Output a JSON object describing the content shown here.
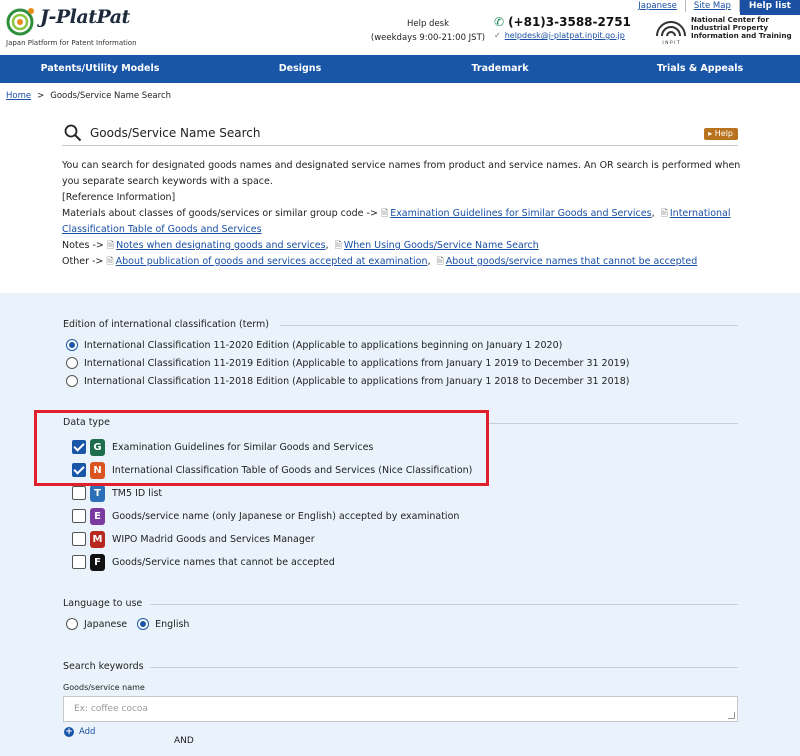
{
  "header": {
    "logo_text": "J-PlatPat",
    "logo_sub": "Japan Platform for Patent Information",
    "helpdesk_label": "Help desk",
    "helpdesk_hours": "(weekdays 9:00-21:00 JST)",
    "phone": "(+81)3-3588-2751",
    "email": "helpdesk@j-platpat.inpit.go.jp",
    "inpit_lines": [
      "National Center for",
      "Industrial Property",
      "Information and Training"
    ],
    "inpit_mark_text": "I N P I T",
    "top_links": {
      "japanese": "Japanese",
      "site_map": "Site Map",
      "help_list": "Help list"
    }
  },
  "nav": [
    "Patents/Utility Models",
    "Designs",
    "Trademark",
    "Trials & Appeals"
  ],
  "breadcrumb": {
    "home": "Home",
    "sep": ">",
    "current": "Goods/Service Name Search"
  },
  "page": {
    "title": "Goods/Service Name Search",
    "help_label": "Help",
    "intro": "You can search for designated goods names and designated service names from product and service names. An OR search is performed when you separate search keywords with a space.",
    "ref_info": "[Reference Information]",
    "materials_prefix": "Materials about classes of goods/services or similar group code ->",
    "materials_link1": "Examination Guidelines for Similar Goods and Services",
    "materials_link2": "International Classification Table of Goods and Services",
    "notes_prefix": "Notes ->",
    "notes_link1": "Notes when designating goods and services",
    "notes_link2": "When Using Goods/Service Name Search",
    "other_prefix": "Other ->",
    "other_link1": "About publication of goods and services accepted at examination",
    "other_link2": "About goods/service names that cannot be accepted"
  },
  "edition": {
    "label": "Edition of international classification (term)",
    "options": [
      "International Classification 11-2020 Edition (Applicable to applications beginning on January 1 2020)",
      "International Classification 11-2019 Edition (Applicable to applications from January 1 2019 to December 31 2019)",
      "International Classification 11-2018 Edition (Applicable to applications from January 1 2018 to December 31 2018)"
    ],
    "selected_index": 0
  },
  "data_type": {
    "label": "Data type",
    "items": [
      {
        "letter": "G",
        "color": "#1e6e4e",
        "label": "Examination Guidelines for Similar Goods and Services",
        "checked": true
      },
      {
        "letter": "N",
        "color": "#d9541e",
        "label": "International Classification Table of Goods and Services (Nice Classification)",
        "checked": true
      },
      {
        "letter": "T",
        "color": "#2a6fb8",
        "label": "TM5 ID list",
        "checked": false
      },
      {
        "letter": "E",
        "color": "#7b3aa0",
        "label": "Goods/service name (only Japanese or English) accepted by examination",
        "checked": false
      },
      {
        "letter": "M",
        "color": "#b8281e",
        "label": "WIPO Madrid Goods and Services Manager",
        "checked": false
      },
      {
        "letter": "F",
        "color": "#111111",
        "label": "Goods/Service names that cannot be accepted",
        "checked": false
      }
    ]
  },
  "language": {
    "label": "Language to use",
    "japanese": "Japanese",
    "english": "English",
    "selected": "English"
  },
  "keywords": {
    "label": "Search keywords",
    "field_label": "Goods/service name",
    "placeholder": "Ex: coffee cocoa",
    "add_label": "Add",
    "and_label": "AND"
  }
}
